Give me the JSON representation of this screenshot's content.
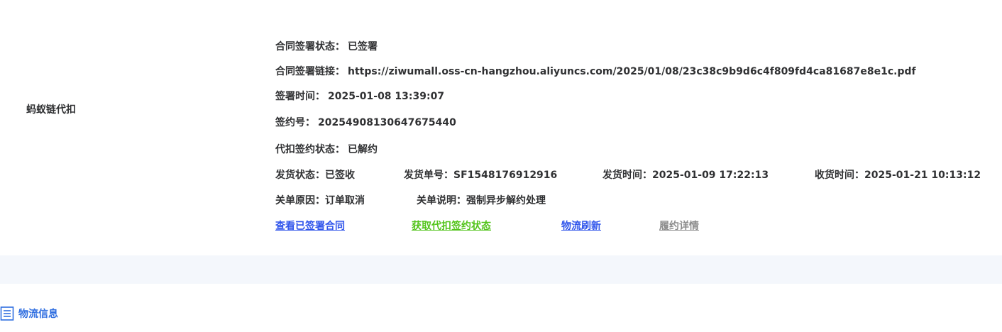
{
  "payment": {
    "method_label": "蚂蚁链代扣",
    "contract_status": {
      "label": "合同签署状态：",
      "value": "已签署"
    },
    "contract_link": {
      "label": "合同签署链接：",
      "value": "https://ziwumall.oss-cn-hangzhou.aliyuncs.com/2025/01/08/23c38c9b9d6c4f809fd4ca81687e8e1c.pdf"
    },
    "sign_time": {
      "label": "签署时间：",
      "value": "2025-01-08 13:39:07"
    },
    "sign_no": {
      "label": "签约号：",
      "value": "20254908130647675440"
    },
    "withhold_status": {
      "label": "代扣签约状态：",
      "value": "已解约"
    },
    "shipping": {
      "status": "发货状态：已签收",
      "tracking_no": "发货单号：SF1548176912916",
      "ship_time": "发货时间：2025-01-09 17:22:13",
      "receive_time": "收货时间：2025-01-21 10:13:12"
    },
    "close": {
      "reason": "关单原因：订单取消",
      "note": "关单说明：强制异步解约处理"
    },
    "actions": {
      "view_contract": "查看已签署合同",
      "get_withhold_status": "获取代扣签约状态",
      "refresh_logistics": "物流刷新",
      "fulfillment_details": "履约详情"
    },
    "colors": {
      "view_contract": "#2f54eb",
      "get_withhold_status": "#52c41a",
      "refresh_logistics": "#2f54eb",
      "fulfillment_details": "#8c8c8c"
    }
  },
  "logistics_section": {
    "title": "物流信息",
    "icon": "list-document-icon",
    "accent": "#2f6ee0"
  }
}
